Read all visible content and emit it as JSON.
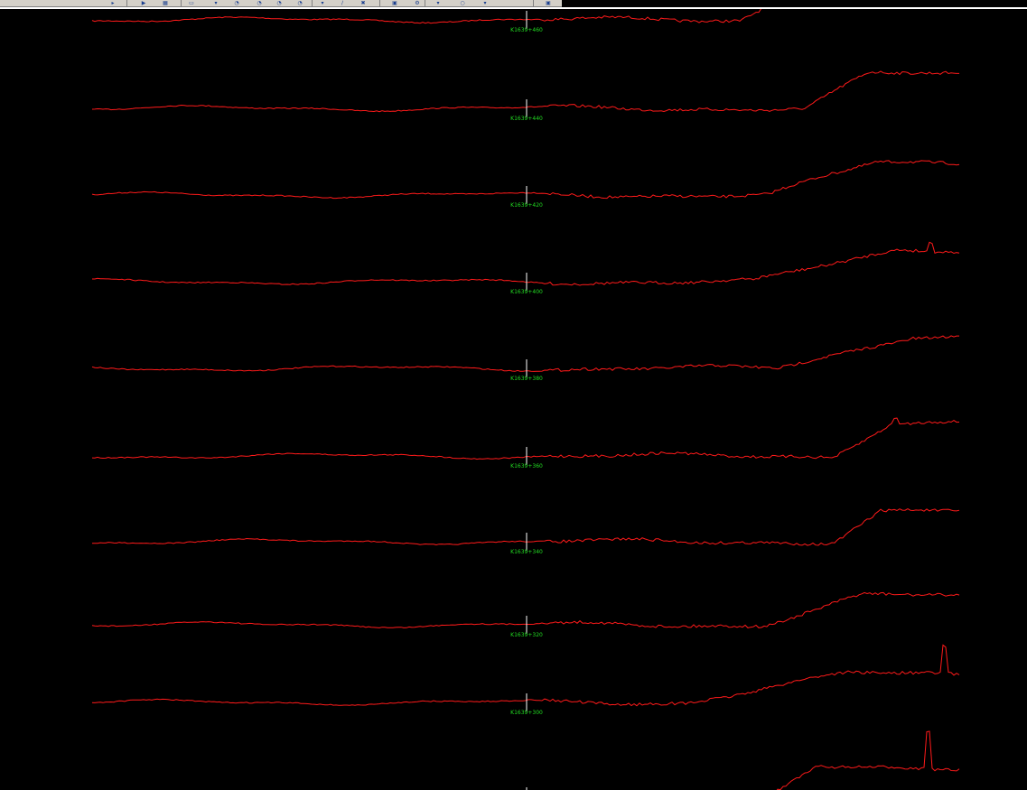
{
  "toolbar": {
    "buttons": [
      {
        "name": "tool-arrow-icon",
        "glyph": "▸"
      },
      {
        "name": "tool-play-icon",
        "glyph": "▶"
      },
      {
        "name": "tool-grid-icon",
        "glyph": "▦"
      },
      {
        "name": "tool-monitor-icon",
        "glyph": "▭"
      },
      {
        "name": "tool-down-icon",
        "glyph": "▾"
      },
      {
        "name": "tool-zoom-in-icon",
        "glyph": "◔"
      },
      {
        "name": "tool-zoom-icon",
        "glyph": "◔"
      },
      {
        "name": "tool-zoom-out-icon",
        "glyph": "◔"
      },
      {
        "name": "tool-zoom-fit-icon",
        "glyph": "◔"
      },
      {
        "name": "tool-pin-icon",
        "glyph": "▾"
      },
      {
        "name": "tool-pen-icon",
        "glyph": "∕"
      },
      {
        "name": "tool-scissors-icon",
        "glyph": "✖"
      },
      {
        "name": "tool-image-icon",
        "glyph": "▣"
      },
      {
        "name": "tool-settings-icon",
        "glyph": "⚙"
      },
      {
        "name": "tool-marker-icon",
        "glyph": "▾"
      },
      {
        "name": "tool-key-icon",
        "glyph": "○"
      },
      {
        "name": "tool-dropdown-icon",
        "glyph": "▾"
      },
      {
        "name": "tool-window-icon",
        "glyph": "▣"
      }
    ]
  },
  "colors": {
    "background": "#000000",
    "trace": "#ff1a1a",
    "marker": "#ffffff",
    "label": "#22dd22"
  },
  "chart_data": {
    "type": "line",
    "rows": [
      {
        "label": "K1639+460"
      },
      {
        "label": "K1639+440"
      },
      {
        "label": "K1639+420"
      },
      {
        "label": "K1639+400"
      },
      {
        "label": "K1639+380"
      },
      {
        "label": "K1639+360"
      },
      {
        "label": "K1639+340"
      },
      {
        "label": "K1639+320"
      },
      {
        "label": "K1639+300"
      },
      {
        "label": ""
      }
    ]
  }
}
